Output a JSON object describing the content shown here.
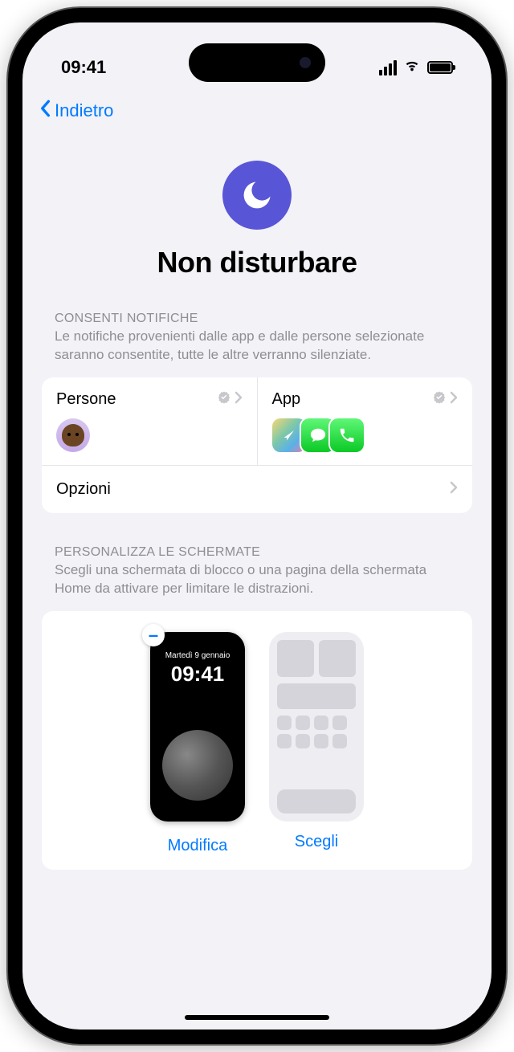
{
  "status": {
    "time": "09:41"
  },
  "nav": {
    "back": "Indietro"
  },
  "hero": {
    "title": "Non disturbare",
    "icon": "moon-icon"
  },
  "notifications": {
    "header": "CONSENTI NOTIFICHE",
    "description": "Le notifiche provenienti dalle app e dalle persone selezionate saranno consentite, tutte le altre verranno silenziate.",
    "people_label": "Persone",
    "apps_label": "App",
    "options_label": "Opzioni"
  },
  "customize": {
    "header": "PERSONALIZZA LE SCHERMATE",
    "description": "Scegli una schermata di blocco o una pagina della schermata Home da attivare per limitare le distrazioni.",
    "lock_preview": {
      "date": "Martedì 9 gennaio",
      "time": "09:41"
    },
    "edit_label": "Modifica",
    "choose_label": "Scegli"
  }
}
